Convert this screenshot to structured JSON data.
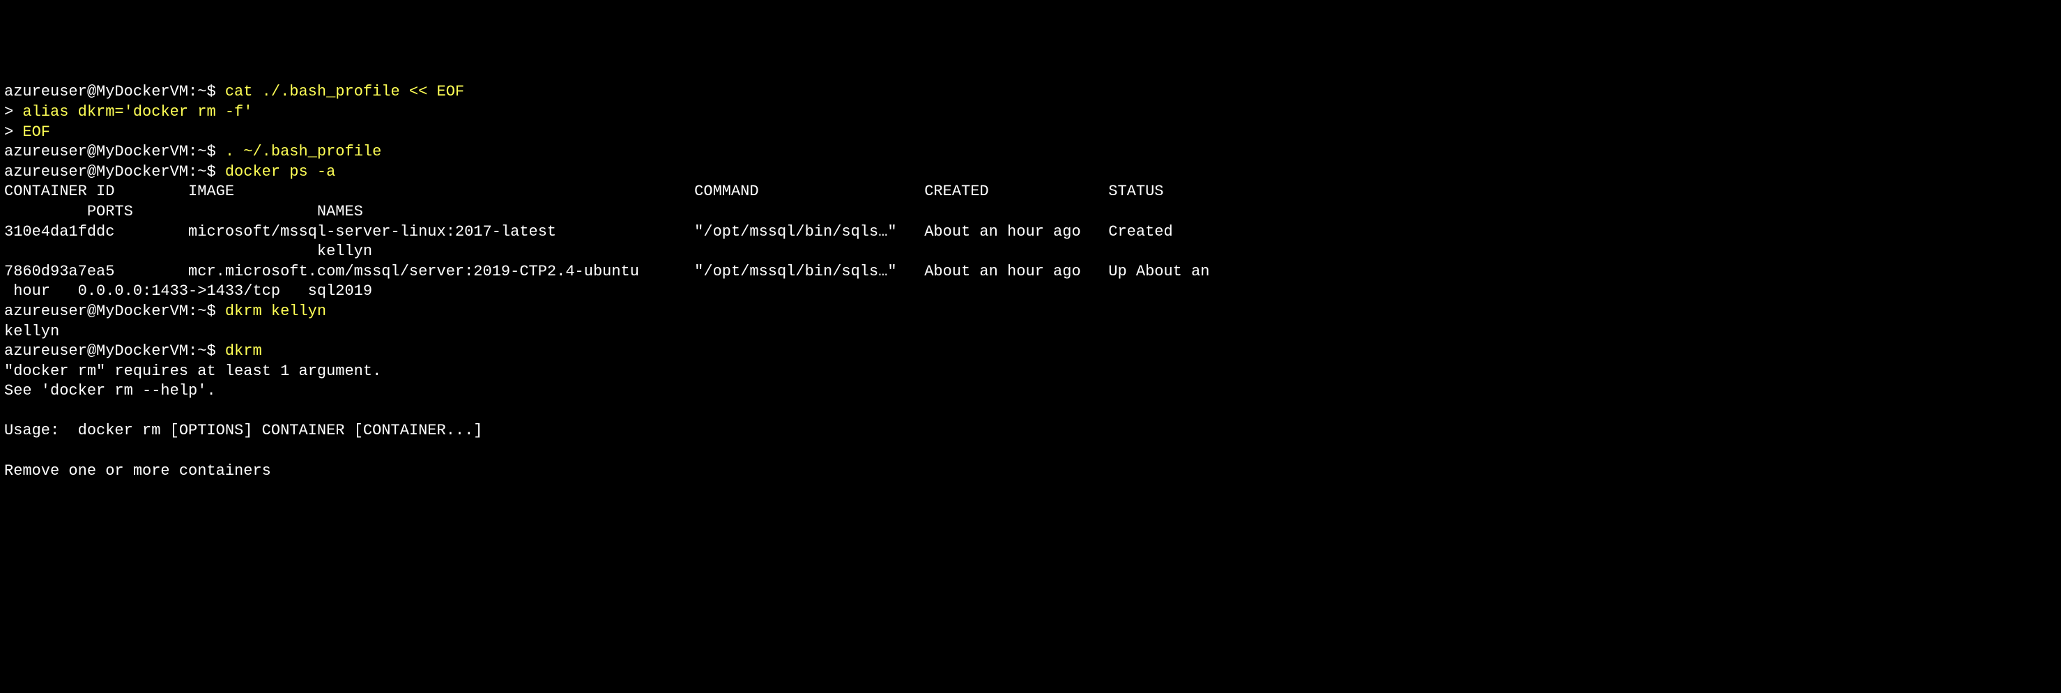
{
  "terminal": {
    "lines": [
      {
        "prompt": "azureuser@MyDockerVM:~$ ",
        "cmd": "cat ./.bash_profile << EOF"
      },
      {
        "cont_prompt": "> ",
        "cmd": "alias dkrm='docker rm -f'"
      },
      {
        "cont_prompt": "> ",
        "cmd": "EOF"
      },
      {
        "prompt": "azureuser@MyDockerVM:~$ ",
        "cmd": ". ~/.bash_profile"
      },
      {
        "prompt": "azureuser@MyDockerVM:~$ ",
        "cmd": "docker ps -a"
      },
      {
        "out": "CONTAINER ID        IMAGE                                                  COMMAND                  CREATED             STATUS"
      },
      {
        "out": "         PORTS                    NAMES"
      },
      {
        "out": "310e4da1fddc        microsoft/mssql-server-linux:2017-latest               \"/opt/mssql/bin/sqls…\"   About an hour ago   Created"
      },
      {
        "out": "                                  kellyn"
      },
      {
        "out": "7860d93a7ea5        mcr.microsoft.com/mssql/server:2019-CTP2.4-ubuntu      \"/opt/mssql/bin/sqls…\"   About an hour ago   Up About an"
      },
      {
        "out": " hour   0.0.0.0:1433->1433/tcp   sql2019"
      },
      {
        "prompt": "azureuser@MyDockerVM:~$ ",
        "cmd": "dkrm kellyn"
      },
      {
        "out": "kellyn"
      },
      {
        "prompt": "azureuser@MyDockerVM:~$ ",
        "cmd": "dkrm"
      },
      {
        "out": "\"docker rm\" requires at least 1 argument."
      },
      {
        "out": "See 'docker rm --help'."
      },
      {
        "out": ""
      },
      {
        "out": "Usage:  docker rm [OPTIONS] CONTAINER [CONTAINER...]"
      },
      {
        "out": ""
      },
      {
        "out": "Remove one or more containers"
      }
    ]
  }
}
